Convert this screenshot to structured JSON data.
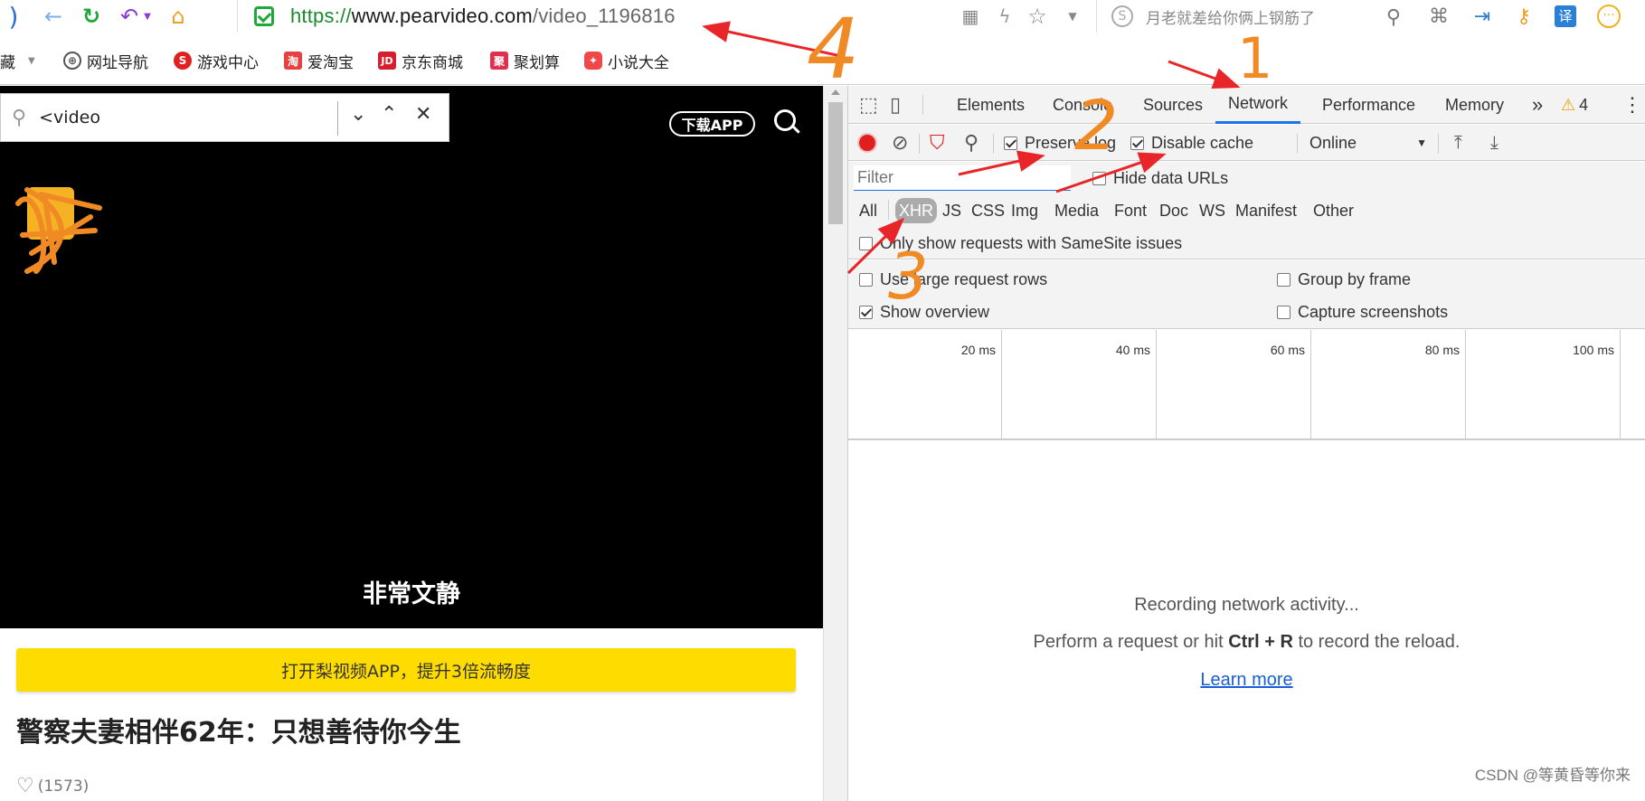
{
  "browser": {
    "url_scheme": "https://",
    "url_host": "www.pearvideo.com",
    "url_path": "/video_1196816",
    "search_placeholder": "月老就差给你俩上钢筋了",
    "ext_translate_label": "译"
  },
  "bookmarks": {
    "items": [
      {
        "label": "藏",
        "icon": "folder-icon"
      },
      {
        "label": "网址导航",
        "icon": "globe-icon"
      },
      {
        "label": "游戏中心",
        "icon": "game-icon"
      },
      {
        "label": "爱淘宝",
        "icon": "taobao-icon",
        "icon_text": "淘"
      },
      {
        "label": "京东商城",
        "icon": "jd-icon",
        "icon_text": "JD"
      },
      {
        "label": "聚划算",
        "icon": "juhuasuan-icon",
        "icon_text": "聚"
      },
      {
        "label": "小说大全",
        "icon": "novel-icon"
      }
    ]
  },
  "page": {
    "find_text": "<video",
    "download_app": "下载APP",
    "caption": "非常文静",
    "promo_bar": "打开梨视频APP，提升3倍流畅度",
    "title": "警察夫妻相伴62年：只想善待你今生",
    "likes": "(1573)"
  },
  "devtools": {
    "tabs": [
      "Elements",
      "Console",
      "Sources",
      "Network",
      "Performance",
      "Memory"
    ],
    "active_tab": "Network",
    "more_tabs": "»",
    "warning_count": "4",
    "toolbar": {
      "preserve_log": "Preserve log",
      "disable_cache": "Disable cache",
      "throttle": "Online"
    },
    "filter_placeholder": "Filter",
    "hide_data_urls": "Hide data URLs",
    "types": [
      "All",
      "XHR",
      "JS",
      "CSS",
      "Img",
      "Media",
      "Font",
      "Doc",
      "WS",
      "Manifest",
      "Other"
    ],
    "selected_type": "XHR",
    "samesite": "Only show requests with SameSite issues",
    "settings": {
      "large_rows": "Use large request rows",
      "group_by_frame": "Group by frame",
      "show_overview": "Show overview",
      "capture_screenshots": "Capture screenshots"
    },
    "timeline": [
      "20 ms",
      "40 ms",
      "60 ms",
      "80 ms",
      "100 ms"
    ],
    "empty": {
      "line1": "Recording network activity...",
      "line2_prefix": "Perform a request or hit ",
      "shortcut": "Ctrl + R",
      "line2_suffix": " to record the reload.",
      "learn_more": "Learn more"
    }
  },
  "annotations": {
    "labels": [
      "1",
      "2",
      "3",
      "4"
    ],
    "color": "#f08a24",
    "arrow_color": "#e8262a"
  },
  "watermark": "CSDN @等黄昏等你来"
}
